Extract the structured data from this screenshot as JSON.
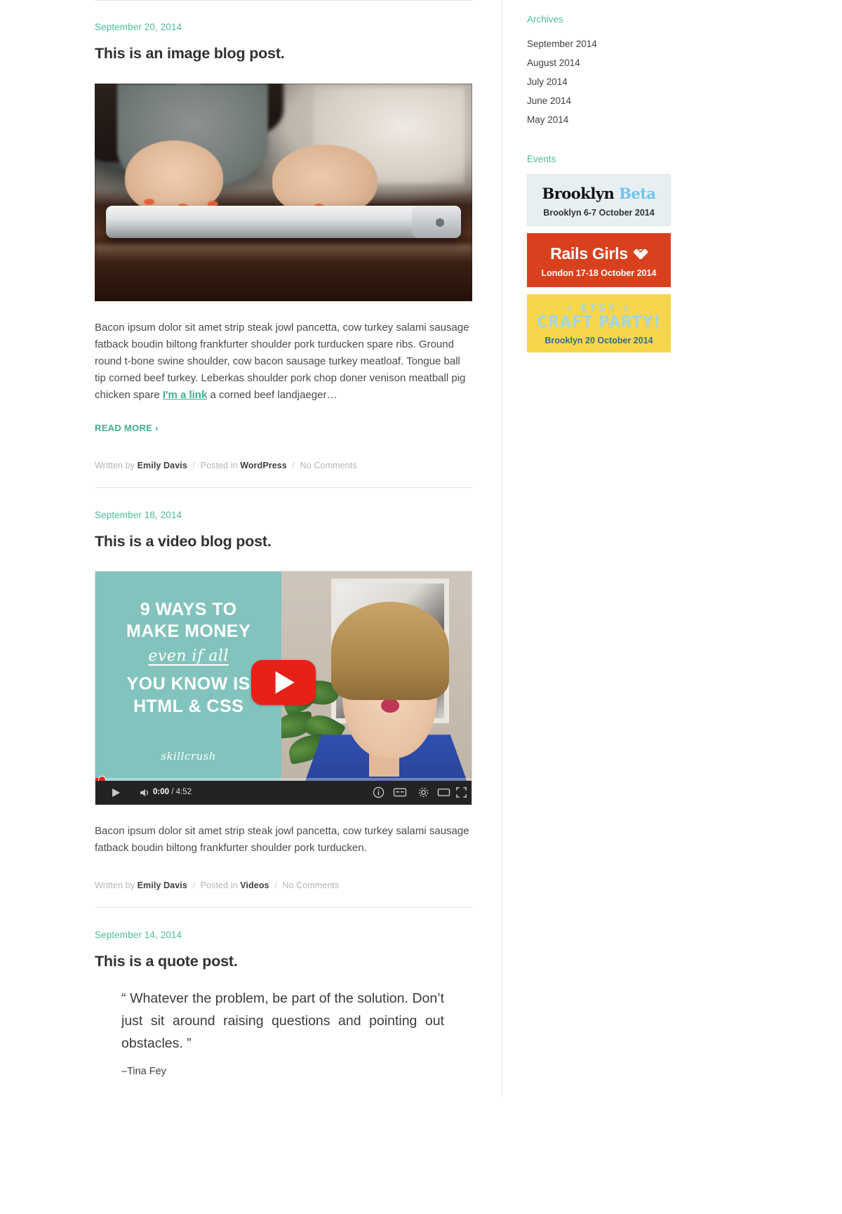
{
  "theme": {
    "accent": "#4dbd9a",
    "link": "#3fae8e",
    "text": "#3f3f3f",
    "muted": "#b4b4b4"
  },
  "posts": [
    {
      "date": "September 20, 2014",
      "title": "This is an image blog post.",
      "body_before_link": "Bacon ipsum dolor sit amet strip steak jowl pancetta, cow turkey salami sausage fatback boudin biltong frankfurter shoulder pork turducken spare ribs. Ground round t-bone swine shoulder, cow bacon sausage turkey meatloaf. Tongue ball tip corned beef turkey. Leberkas shoulder pork chop doner venison meatball pig chicken spare ",
      "link_text": "I'm a link",
      "body_after_link": " a corned beef landjaeger…",
      "read_more": "READ MORE ›",
      "meta": {
        "written_by_label": "Written by",
        "author": "Emily Davis",
        "posted_in_label": "Posted in",
        "category": "WordPress",
        "comments": "No Comments",
        "separator": "/"
      }
    },
    {
      "date": "September 18, 2014",
      "title": "This is a video blog post.",
      "video": {
        "line1": "9 WAYS TO",
        "line2": "MAKE MONEY",
        "script": "even if all",
        "line3": "YOU KNOW IS",
        "line4": "HTML & CSS",
        "brand": "skillcrush",
        "play_button": "play-button",
        "current_time": "0:00",
        "time_separator": "/",
        "duration": "4:52"
      },
      "body": "Bacon ipsum dolor sit amet strip steak jowl pancetta, cow turkey salami sausage fatback boudin biltong frankfurter shoulder pork turducken.",
      "meta": {
        "written_by_label": "Written by",
        "author": "Emily Davis",
        "posted_in_label": "Posted in",
        "category": "Videos",
        "comments": "No Comments",
        "separator": "/"
      }
    },
    {
      "date": "September 14, 2014",
      "title": "This is a quote post.",
      "quote": "“ Whatever the problem, be part of the solution. Don’t just sit around raising questions and pointing out obstacles. ”",
      "cite": "–Tina Fey"
    }
  ],
  "sidebar": {
    "archives": {
      "title": "Archives",
      "items": [
        "September 2014",
        "August 2014",
        "July 2014",
        "June 2014",
        "May 2014"
      ]
    },
    "events": {
      "title": "Events",
      "items": [
        {
          "logo_main": "Brooklyn",
          "logo_alt": "Beta",
          "when": "Brooklyn 6-7 October 2014"
        },
        {
          "logo_main": "Rails Girls",
          "logo_alt": "heart-icon",
          "when": "London 17-18 October 2014"
        },
        {
          "logo_main": "ETSY",
          "logo_alt": "CRAFT PARTY!",
          "when": "Brooklyn 20 October 2014"
        }
      ]
    }
  }
}
